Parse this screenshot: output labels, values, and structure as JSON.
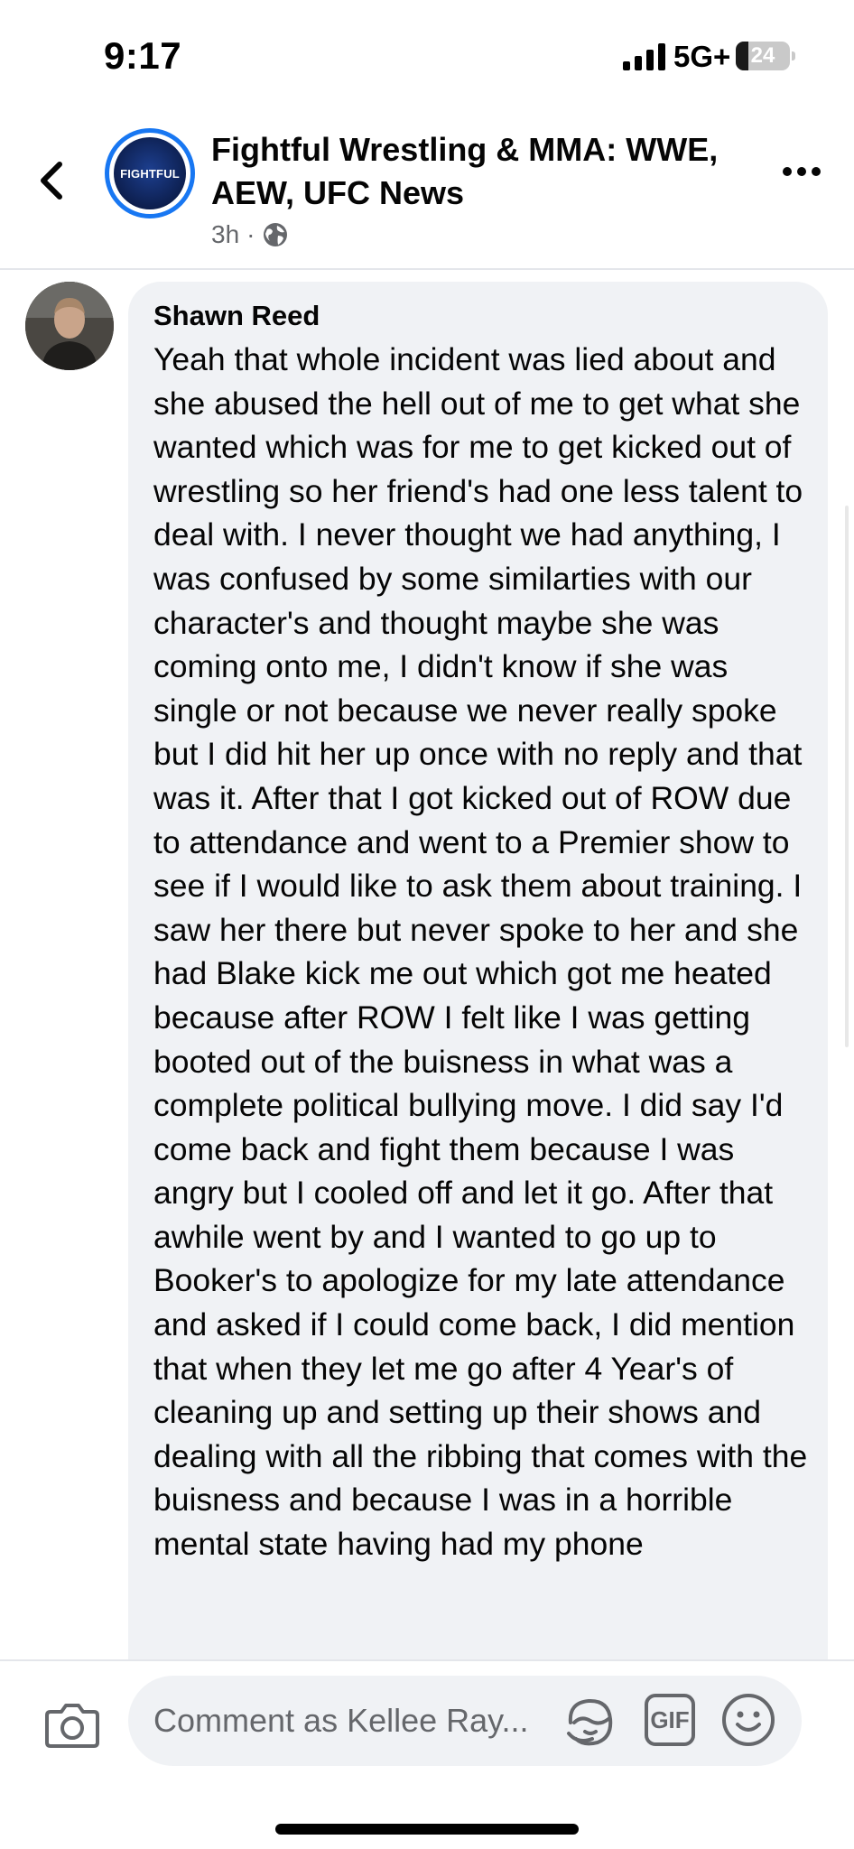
{
  "status_bar": {
    "time": "9:17",
    "network": "5G+",
    "battery": "24",
    "battery_level": 0.24
  },
  "header": {
    "page_avatar_text": "FIGHTFUL",
    "page_name": "Fightful Wrestling & MMA: WWE, AEW, UFC News",
    "time_ago": "3h",
    "separator": "·",
    "back_icon": "chevron-left-icon",
    "privacy_icon": "globe-icon",
    "more_icon": "more-icon"
  },
  "comment": {
    "author": "Shawn Reed",
    "text": "Yeah that whole incident was lied about and she abused the hell out of me to get what she wanted which was for me to get kicked out of wrestling so her friend's had one less talent to deal with. I never thought we had anything, I was confused by some similarties with our character's and thought maybe she was coming onto me, I didn't know if she was single or not because we never really spoke but I did hit her up once with no reply and that was it. After that I got kicked out of ROW due to attendance and went to a Premier show to see if I would like to ask them about training. I saw her there but never spoke to her and she had Blake kick me out which got me heated because after ROW I felt like I was getting booted out of the buisness in what was a complete political bullying move. I did say I'd come back and fight them because I was angry but I cooled off and let it go. After that awhile went by and I wanted to go up to Booker's to apologize for my late attendance and asked if I could come back, I did mention that when they let me go after 4 Year's of cleaning up and setting up their shows and dealing with all the ribbing that comes with the buisness and because I was in a horrible mental state having had my phone"
  },
  "composer": {
    "placeholder": "Comment as Kellee Ray...",
    "gif_label": "GIF",
    "camera_icon": "camera-icon",
    "sticker_icon": "avatar-sticker-icon",
    "emoji_icon": "emoji-icon"
  },
  "colors": {
    "accent": "#1877f2",
    "bubble": "#f0f2f5",
    "secondary_text": "#65676b"
  }
}
